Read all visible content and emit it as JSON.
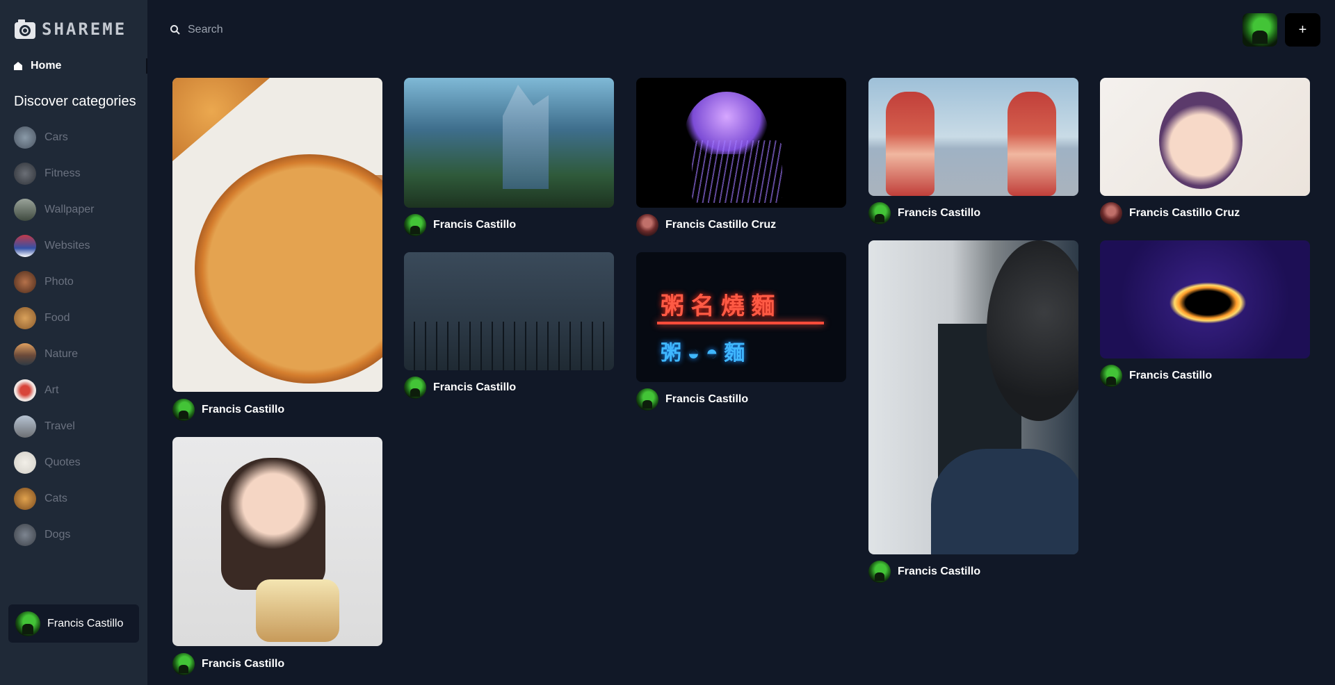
{
  "app": {
    "logo": "SHAREME"
  },
  "sidebar": {
    "home_label": "Home",
    "discover_title": "Discover categories",
    "categories": [
      {
        "label": "Cars"
      },
      {
        "label": "Fitness"
      },
      {
        "label": "Wallpaper"
      },
      {
        "label": "Websites"
      },
      {
        "label": "Photo"
      },
      {
        "label": "Food"
      },
      {
        "label": "Nature"
      },
      {
        "label": "Art"
      },
      {
        "label": "Travel"
      },
      {
        "label": "Quotes"
      },
      {
        "label": "Cats"
      },
      {
        "label": "Dogs"
      }
    ],
    "user_name": "Francis Castillo"
  },
  "header": {
    "search_placeholder": "Search",
    "add_label": "+"
  },
  "pins": [
    {
      "image": "pizza",
      "owner": "Francis Castillo"
    },
    {
      "image": "fantasy ruins",
      "owner": "Francis Castillo"
    },
    {
      "image": "jellyfish",
      "owner": "Francis Castillo Cruz"
    },
    {
      "image": "anime",
      "owner": "Francis Castillo"
    },
    {
      "image": "portrait",
      "owner": "Francis Castillo Cruz"
    },
    {
      "image": "balcony anime",
      "owner": "Francis Castillo"
    },
    {
      "image": "neon sign",
      "owner": "Francis Castillo"
    },
    {
      "image": "office",
      "owner": "Francis Castillo"
    },
    {
      "image": "black hole",
      "owner": "Francis Castillo"
    },
    {
      "image": "birthday",
      "owner": "Francis Castillo"
    }
  ],
  "colors": {
    "background": "#111827",
    "sidebar": "#1f2937",
    "muted_text": "#6b7280",
    "accent_button": "#000000"
  }
}
